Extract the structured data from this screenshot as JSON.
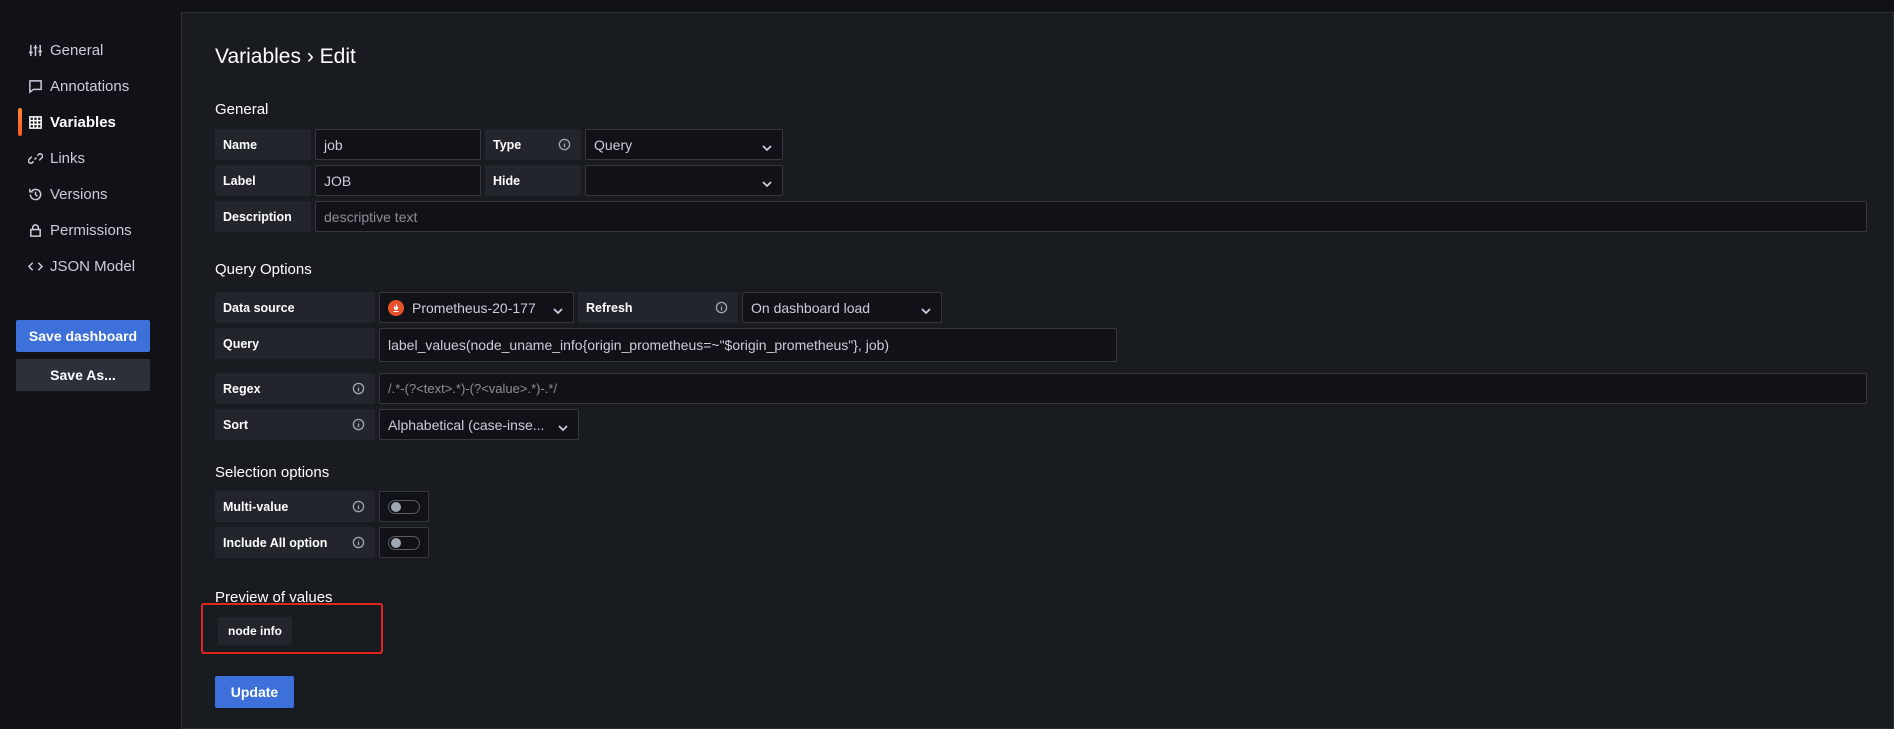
{
  "sidebar": {
    "items": [
      {
        "label": "General",
        "icon": "sliders-icon"
      },
      {
        "label": "Annotations",
        "icon": "comment-icon"
      },
      {
        "label": "Variables",
        "icon": "grid-icon",
        "active": true
      },
      {
        "label": "Links",
        "icon": "link-icon"
      },
      {
        "label": "Versions",
        "icon": "history-icon"
      },
      {
        "label": "Permissions",
        "icon": "lock-icon"
      },
      {
        "label": "JSON Model",
        "icon": "code-icon"
      }
    ],
    "save_dashboard": "Save dashboard",
    "save_as": "Save As..."
  },
  "header": {
    "title": "Variables › Edit"
  },
  "general": {
    "section": "General",
    "name_label": "Name",
    "name_value": "job",
    "type_label": "Type",
    "type_value": "Query",
    "label_label": "Label",
    "label_value": "JOB",
    "hide_label": "Hide",
    "hide_value": "",
    "description_label": "Description",
    "description_placeholder": "descriptive text"
  },
  "query_options": {
    "section": "Query Options",
    "datasource_label": "Data source",
    "datasource_value": "Prometheus-20-177",
    "refresh_label": "Refresh",
    "refresh_value": "On dashboard load",
    "query_label": "Query",
    "query_value": "label_values(node_uname_info{origin_prometheus=~\"$origin_prometheus\"}, job)",
    "regex_label": "Regex",
    "regex_placeholder": "/.*-(?<text>.*)-(?<value>.*)-.*/",
    "sort_label": "Sort",
    "sort_value": "Alphabetical (case-inse..."
  },
  "selection": {
    "section": "Selection options",
    "multi_label": "Multi-value",
    "include_all_label": "Include All option"
  },
  "preview": {
    "section": "Preview of values",
    "values": [
      "node info"
    ]
  },
  "update_label": "Update",
  "colors": {
    "primary": "#3d71d9",
    "accent": "#f05a28",
    "highlight": "#e0261f"
  }
}
